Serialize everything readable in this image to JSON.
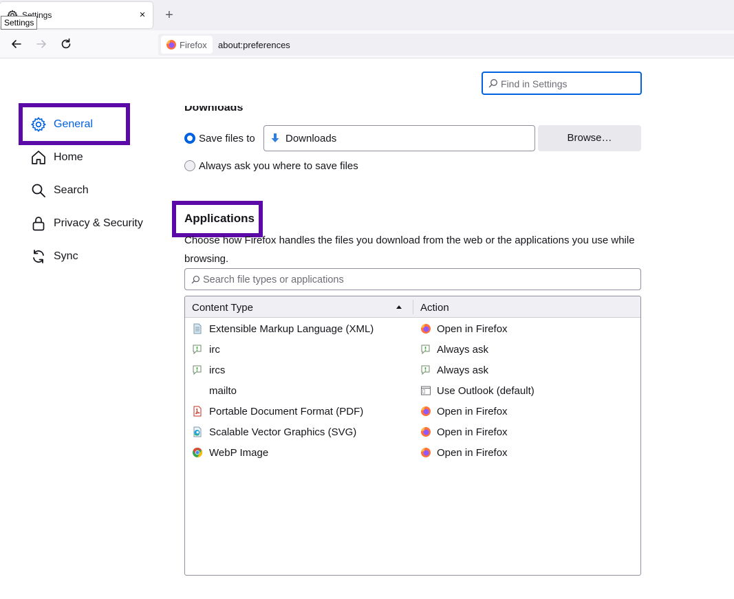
{
  "tab": {
    "title": "Settings",
    "tooltip": "Settings",
    "close": "×",
    "new_tab": "+"
  },
  "urlbar": {
    "identity_label": "Firefox",
    "url": "about:preferences"
  },
  "find": {
    "placeholder": "Find in Settings"
  },
  "sidebar": {
    "items": [
      {
        "label": "General",
        "icon": "gear-icon",
        "selected": true
      },
      {
        "label": "Home",
        "icon": "home-icon"
      },
      {
        "label": "Search",
        "icon": "search-icon"
      },
      {
        "label": "Privacy & Security",
        "icon": "lock-icon"
      },
      {
        "label": "Sync",
        "icon": "sync-icon"
      }
    ]
  },
  "downloads": {
    "heading": "Downloads",
    "save_files_label": "Save files to",
    "folder": "Downloads",
    "browse_label": "Browse…",
    "always_ask_label": "Always ask you where to save files",
    "selected_option": "save_files"
  },
  "applications": {
    "heading": "Applications",
    "description": "Choose how Firefox handles the files you download from the web or the applications you use while browsing.",
    "search_placeholder": "Search file types or applications",
    "columns": {
      "content_type": "Content Type",
      "action": "Action"
    },
    "rows": [
      {
        "content_type": "Extensible Markup Language (XML)",
        "type_icon": "xml-file-icon",
        "action": "Open in Firefox",
        "action_icon": "firefox-icon"
      },
      {
        "content_type": "irc",
        "type_icon": "chat-icon",
        "action": "Always ask",
        "action_icon": "chat-icon"
      },
      {
        "content_type": "ircs",
        "type_icon": "chat-icon",
        "action": "Always ask",
        "action_icon": "chat-icon"
      },
      {
        "content_type": "mailto",
        "type_icon": "",
        "action": "Use Outlook (default)",
        "action_icon": "app-window-icon"
      },
      {
        "content_type": "Portable Document Format (PDF)",
        "type_icon": "pdf-icon",
        "action": "Open in Firefox",
        "action_icon": "firefox-icon"
      },
      {
        "content_type": "Scalable Vector Graphics (SVG)",
        "type_icon": "edge-file-icon",
        "action": "Open in Firefox",
        "action_icon": "firefox-icon"
      },
      {
        "content_type": "WebP Image",
        "type_icon": "chrome-icon",
        "action": "Open in Firefox",
        "action_icon": "firefox-icon"
      }
    ]
  },
  "colors": {
    "accent": "#0061e0",
    "highlight": "#5c0aa7"
  }
}
